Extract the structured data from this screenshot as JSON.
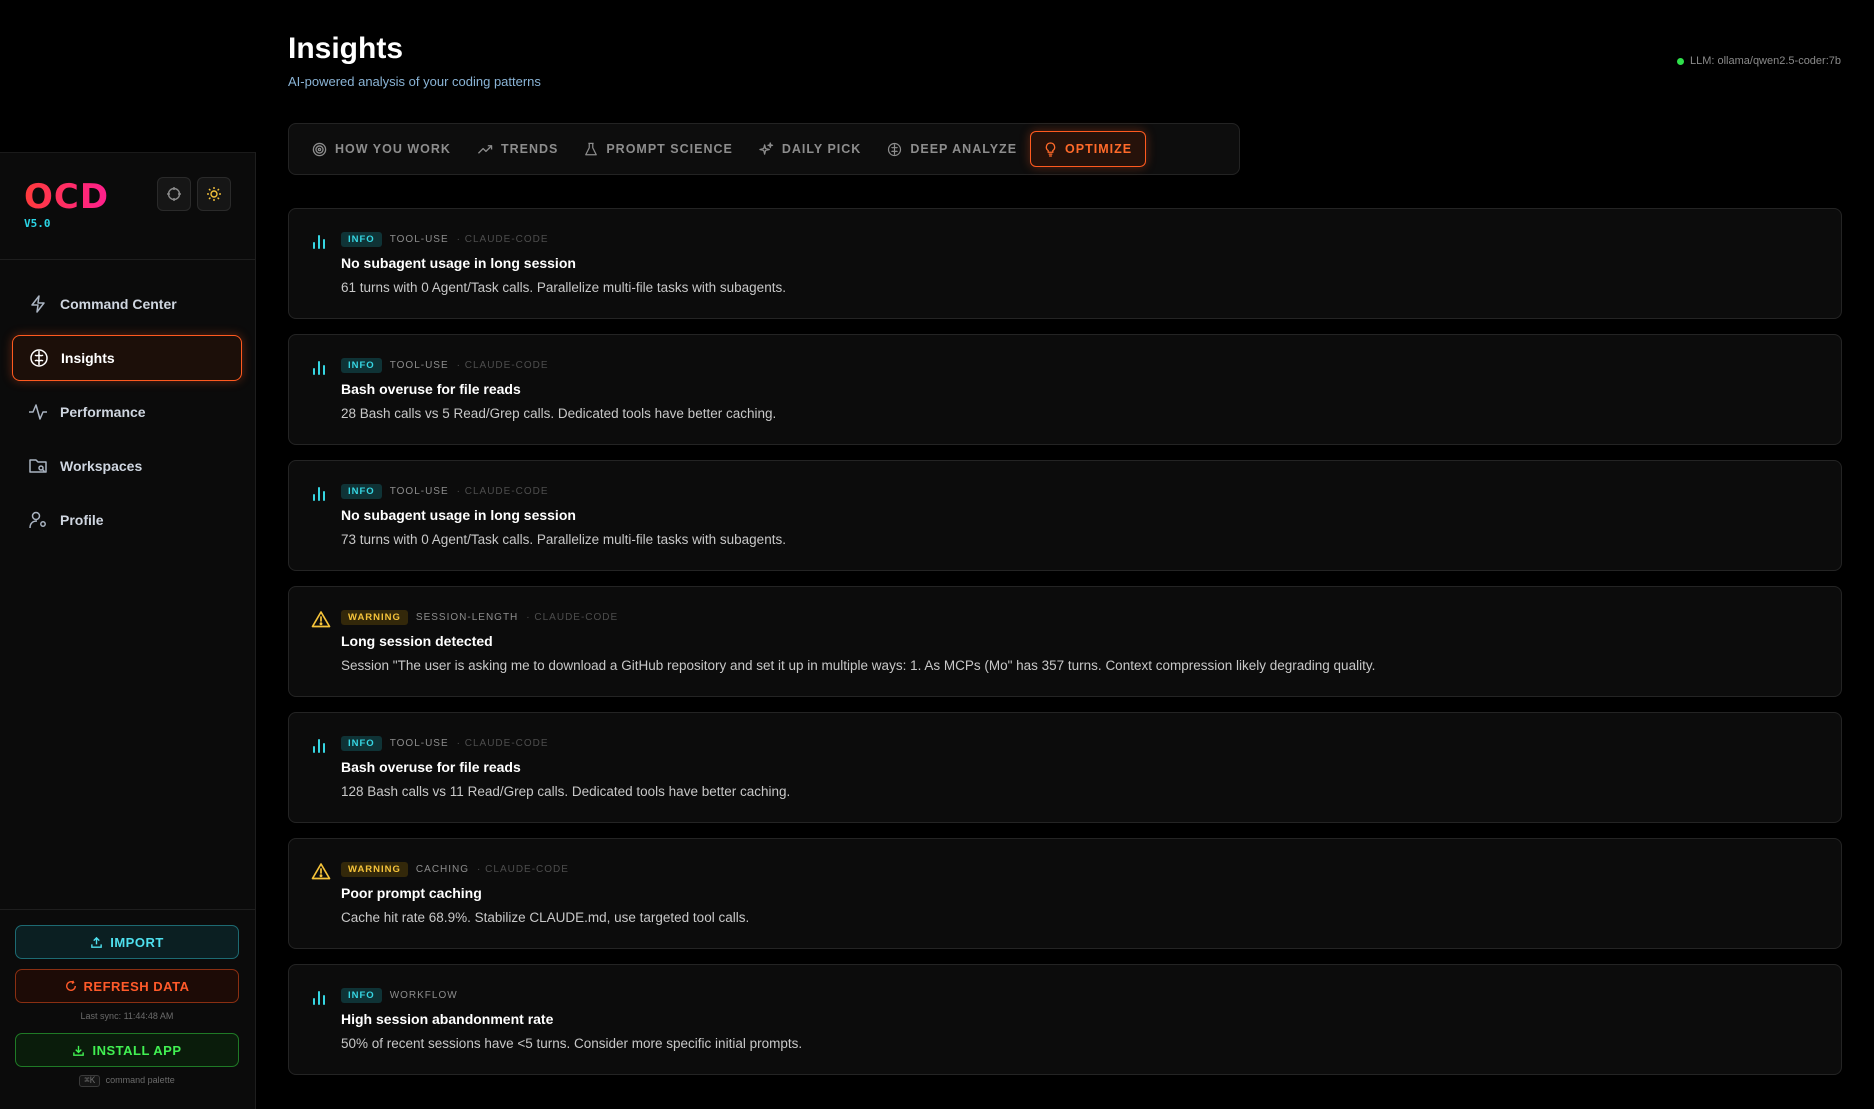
{
  "header": {
    "title": "Insights",
    "subtitle": "AI-powered analysis of your coding patterns",
    "llm_status": "LLM: ollama/qwen2.5-coder:7b"
  },
  "sidebar": {
    "logo": "OCD",
    "version": "V5.0",
    "items": [
      {
        "label": "Command Center",
        "icon": "lightning-icon"
      },
      {
        "label": "Insights",
        "icon": "brain-icon",
        "active": true
      },
      {
        "label": "Performance",
        "icon": "activity-icon"
      },
      {
        "label": "Workspaces",
        "icon": "folder-icon"
      },
      {
        "label": "Profile",
        "icon": "user-cog-icon"
      }
    ],
    "import_label": "IMPORT",
    "refresh_label": "REFRESH DATA",
    "last_sync": "Last sync: 11:44:48 AM",
    "install_label": "INSTALL APP",
    "palette_key": "⌘K",
    "palette_label": "command palette"
  },
  "tabs": [
    {
      "label": "HOW YOU WORK",
      "icon": "target-icon"
    },
    {
      "label": "TRENDS",
      "icon": "trend-up-icon"
    },
    {
      "label": "PROMPT SCIENCE",
      "icon": "flask-icon"
    },
    {
      "label": "DAILY PICK",
      "icon": "sparkles-icon"
    },
    {
      "label": "DEEP ANALYZE",
      "icon": "brain-icon"
    },
    {
      "label": "OPTIMIZE",
      "icon": "lightbulb-icon",
      "active": true
    }
  ],
  "insights": [
    {
      "level": "INFO",
      "category": "TOOL-USE",
      "source": "· CLAUDE-CODE",
      "title": "No subagent usage in long session",
      "description": "61 turns with 0 Agent/Task calls. Parallelize multi-file tasks with subagents."
    },
    {
      "level": "INFO",
      "category": "TOOL-USE",
      "source": "· CLAUDE-CODE",
      "title": "Bash overuse for file reads",
      "description": "28 Bash calls vs 5 Read/Grep calls. Dedicated tools have better caching."
    },
    {
      "level": "INFO",
      "category": "TOOL-USE",
      "source": "· CLAUDE-CODE",
      "title": "No subagent usage in long session",
      "description": "73 turns with 0 Agent/Task calls. Parallelize multi-file tasks with subagents."
    },
    {
      "level": "WARNING",
      "category": "SESSION-LENGTH",
      "source": "· CLAUDE-CODE",
      "title": "Long session detected",
      "description": "Session \"The user is asking me to download a GitHub repository and set it up in multiple ways: 1. As MCPs (Mo\" has 357 turns. Context compression likely degrading quality."
    },
    {
      "level": "INFO",
      "category": "TOOL-USE",
      "source": "· CLAUDE-CODE",
      "title": "Bash overuse for file reads",
      "description": "128 Bash calls vs 11 Read/Grep calls. Dedicated tools have better caching."
    },
    {
      "level": "WARNING",
      "category": "CACHING",
      "source": "· CLAUDE-CODE",
      "title": "Poor prompt caching",
      "description": "Cache hit rate 68.9%. Stabilize CLAUDE.md, use targeted tool calls."
    },
    {
      "level": "INFO",
      "category": "WORKFLOW",
      "source": "",
      "title": "High session abandonment rate",
      "description": "50% of recent sessions have <5 turns. Consider more specific initial prompts."
    }
  ],
  "colors": {
    "accent": "#ff5a1f",
    "info": "#36d6e2",
    "warning": "#f5c33a",
    "success": "#2fe04b"
  }
}
